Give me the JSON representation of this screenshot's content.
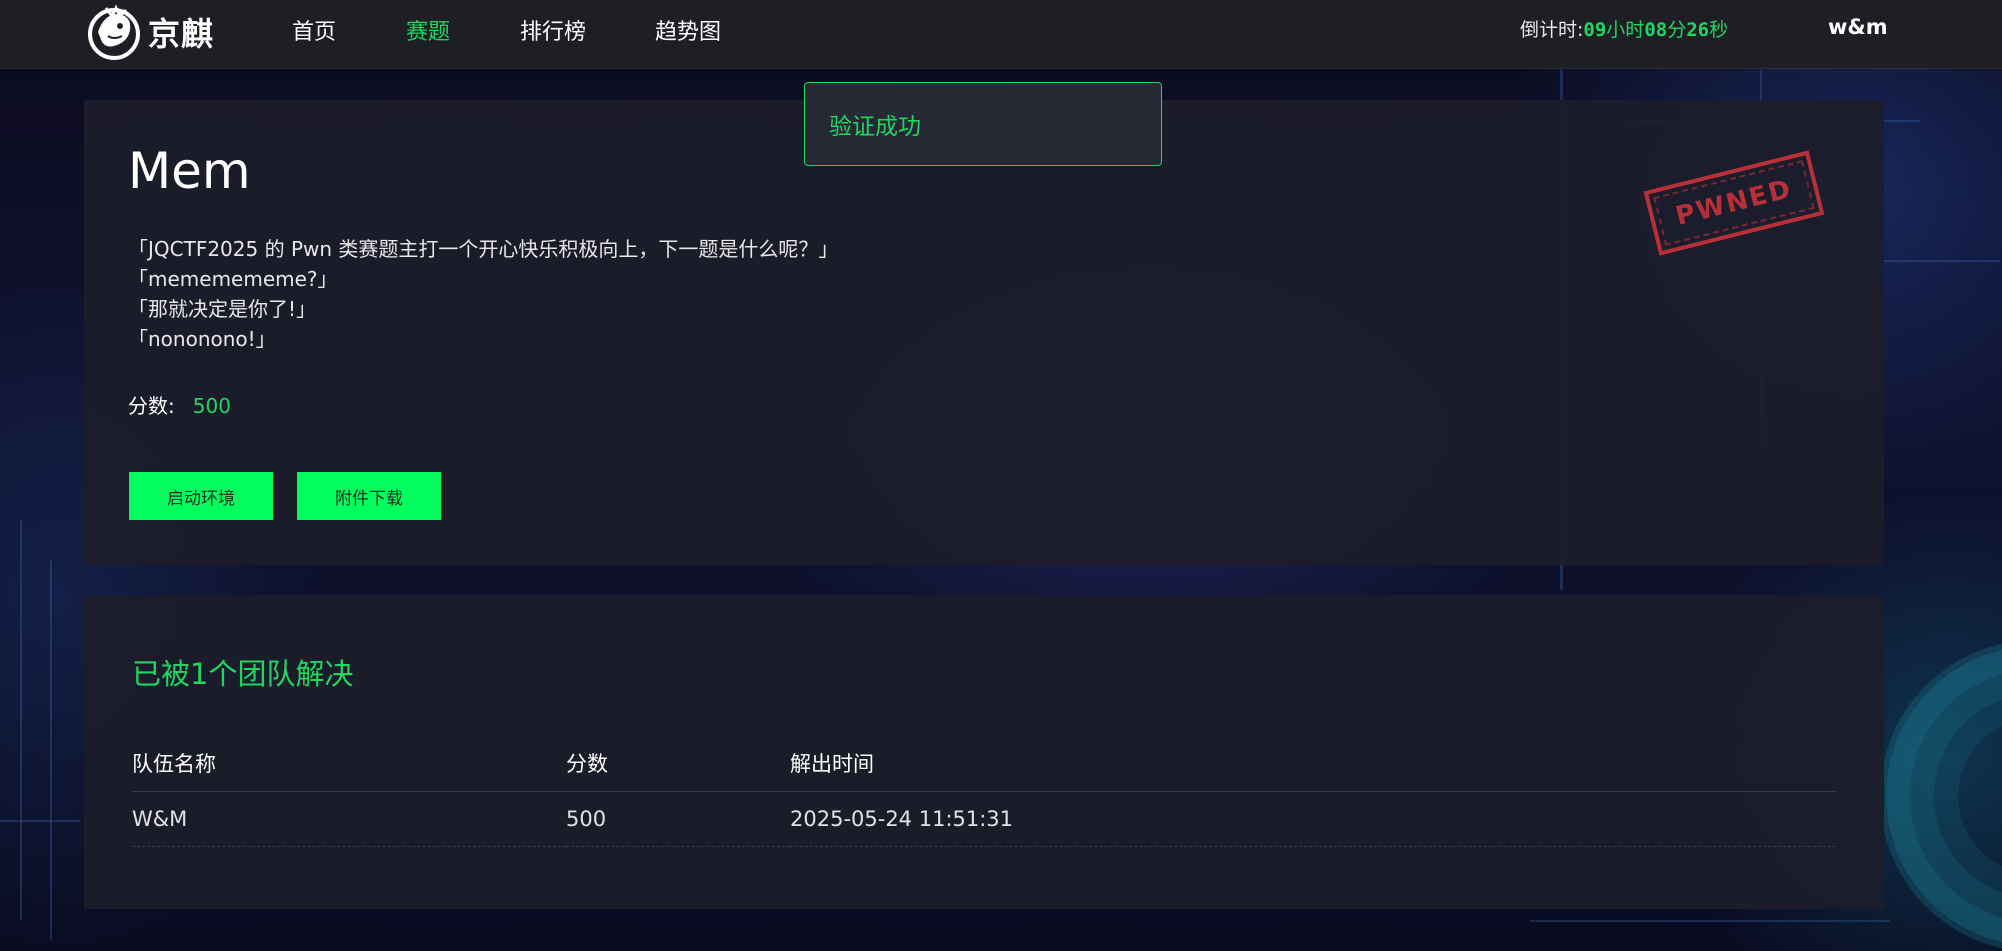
{
  "brand": {
    "name": "京麒",
    "logo_icon": "dragon-logo-icon"
  },
  "nav": {
    "items": [
      {
        "label": "首页",
        "active": false
      },
      {
        "label": "赛题",
        "active": true
      },
      {
        "label": "排行榜",
        "active": false
      },
      {
        "label": "趋势图",
        "active": false
      }
    ]
  },
  "countdown": {
    "label": "倒计时:",
    "hours": "09",
    "hours_unit": "小时",
    "minutes": "08",
    "minutes_unit": "分",
    "seconds": "26",
    "seconds_unit": "秒"
  },
  "user": {
    "name": "w&m"
  },
  "toast": {
    "message": "验证成功"
  },
  "challenge": {
    "title": "Mem",
    "description_lines": [
      "「JQCTF2025 的 Pwn 类赛题主打一个开心快乐积极向上，下一题是什么呢？」",
      "「mememememe?」",
      "「那就决定是你了!」",
      "「nononono!」"
    ],
    "score_label": "分数:",
    "score_value": "500",
    "stamp_text": "PWNED",
    "buttons": {
      "start_env": "启动环境",
      "download": "附件下载"
    }
  },
  "solves": {
    "title": "已被1个团队解决",
    "columns": [
      "队伍名称",
      "分数",
      "解出时间"
    ],
    "rows": [
      {
        "team": "W&M",
        "score": "500",
        "time": "2025-05-24 11:51:31"
      }
    ]
  },
  "colors": {
    "accent_green": "#1ed760",
    "button_green": "#00ff5e",
    "stamp_red": "#c8333a",
    "navbar_bg": "#1e1f25",
    "card_bg": "#1c1d2a"
  }
}
